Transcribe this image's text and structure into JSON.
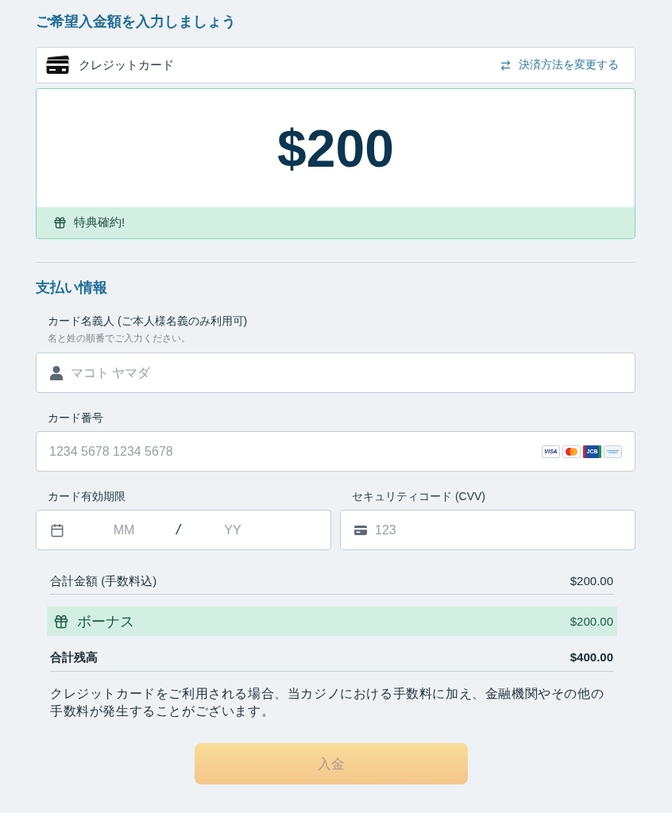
{
  "header": {
    "title": "ご希望入金額を入力しましょう"
  },
  "payment_method": {
    "label": "クレジットカード",
    "change_link": "決済方法を変更する"
  },
  "amount": {
    "value": "$200",
    "bonus_badge": "特典確約!"
  },
  "payment_info": {
    "title": "支払い情報",
    "rows": [
      {
        "fields": [
          {
            "kind": "name",
            "label": "カード名義人 (ご本人様名義のみ利用可)",
            "hint": "名と姓の順番でご入力ください。",
            "placeholder": "マコト ヤマダ"
          }
        ]
      },
      {
        "fields": [
          {
            "kind": "card_number",
            "label": "カード番号",
            "placeholder": "1234 5678 1234 5678",
            "card_brands": [
              {
                "kind": "visa",
                "label": "VISA"
              },
              {
                "kind": "mastercard"
              },
              {
                "kind": "jcb",
                "label": "JCB"
              },
              {
                "kind": "amex"
              }
            ]
          }
        ]
      },
      {
        "fields": [
          {
            "kind": "expiry",
            "label": "カード有効期限",
            "placeholders": [
              "MM",
              "YY"
            ],
            "separator": "/"
          },
          {
            "kind": "cvv",
            "label": "セキュリティコード (CVV)",
            "placeholder": "123"
          }
        ]
      }
    ]
  },
  "summary": {
    "rows": [
      {
        "kind": "subtotal",
        "label": "合計金額 (手数料込)",
        "value": "$200.00"
      },
      {
        "kind": "bonus",
        "label": "ボーナス",
        "value": "$200.00"
      },
      {
        "kind": "total",
        "label": "合計残高",
        "value": "$400.00"
      }
    ]
  },
  "note": "クレジットカードをご利用される場合、当カジノにおける手数料に加え、金融機関やその他の手数料が発生することがございます。",
  "submit": {
    "label": "入金",
    "disabled": true
  }
}
